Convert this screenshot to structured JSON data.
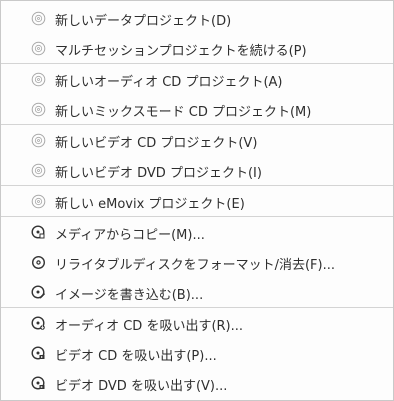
{
  "menu": {
    "groups": [
      {
        "items": [
          {
            "label": "新しいデータプロジェクト(D)",
            "icon": "disc-icon"
          },
          {
            "label": "マルチセッションプロジェクトを続ける(P)",
            "icon": "disc-icon"
          }
        ]
      },
      {
        "items": [
          {
            "label": "新しいオーディオ CD プロジェクト(A)",
            "icon": "disc-icon"
          },
          {
            "label": "新しいミックスモード CD プロジェクト(M)",
            "icon": "disc-icon"
          }
        ]
      },
      {
        "items": [
          {
            "label": "新しいビデオ CD プロジェクト(V)",
            "icon": "disc-icon"
          },
          {
            "label": "新しいビデオ DVD プロジェクト(I)",
            "icon": "disc-icon"
          }
        ]
      },
      {
        "items": [
          {
            "label": "新しい eMovix プロジェクト(E)",
            "icon": "disc-icon"
          }
        ]
      },
      {
        "items": [
          {
            "label": "メディアからコピー(M)...",
            "icon": "copy-media-icon"
          },
          {
            "label": "リライタブルディスクをフォーマット/消去(F)...",
            "icon": "format-disc-icon"
          },
          {
            "label": "イメージを書き込む(B)...",
            "icon": "burn-image-icon"
          }
        ]
      },
      {
        "items": [
          {
            "label": "オーディオ CD を吸い出す(R)...",
            "icon": "rip-audio-icon"
          },
          {
            "label": "ビデオ CD を吸い出す(P)...",
            "icon": "rip-video-cd-icon"
          },
          {
            "label": "ビデオ DVD を吸い出す(V)...",
            "icon": "rip-video-dvd-icon"
          }
        ]
      }
    ]
  }
}
